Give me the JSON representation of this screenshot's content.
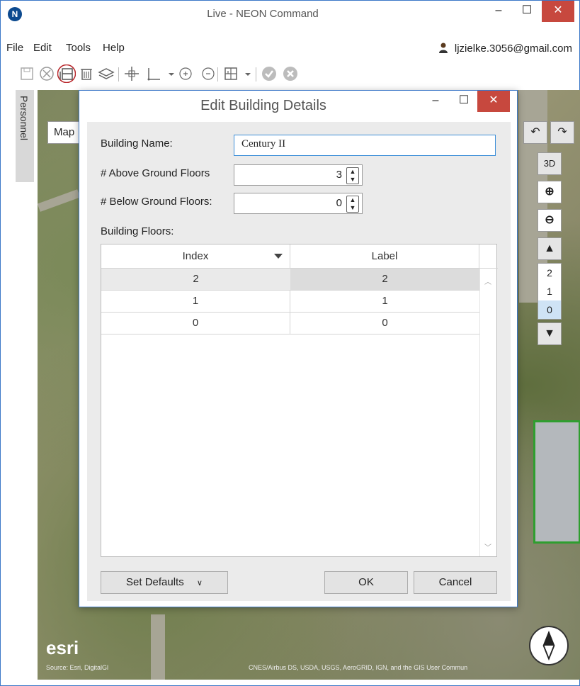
{
  "window": {
    "title": "Live - NEON Command",
    "logo_letter": "N",
    "minimize": "–",
    "maximize": "☐",
    "close": "✕"
  },
  "menu": {
    "items": [
      "File",
      "Edit",
      "Tools",
      "Help"
    ],
    "user_email": "ljzielke.3056@gmail.com"
  },
  "toolbar": {
    "icons": [
      "save-icon",
      "cancel-circle-icon",
      "edit-building-icon",
      "delete-icon",
      "layers-icon",
      "move-icon",
      "draw-line-icon",
      "zoom-in-icon",
      "zoom-out-icon",
      "floor-plan-icon",
      "check-icon",
      "close-circle-icon"
    ]
  },
  "sidetab": {
    "label": "Personnel"
  },
  "map": {
    "tab_label": "Map",
    "btn_3d": "3D",
    "floors": [
      "2",
      "1",
      "0"
    ],
    "selected_floor": "0",
    "esri": "esri",
    "attribution_left": "Source: Esri, DigitalGl",
    "attribution_right": "CNES/Airbus DS, USDA, USGS, AeroGRID, IGN, and the GIS User Commun"
  },
  "dialog": {
    "title": "Edit Building Details",
    "minimize": "–",
    "maximize": "☐",
    "close": "✕",
    "building_name_label": "Building Name:",
    "building_name_value": "Century II",
    "above_label": "# Above Ground Floors",
    "above_value": "3",
    "below_label": "# Below Ground Floors:",
    "below_value": "0",
    "floors_label": "Building Floors:",
    "grid": {
      "columns": [
        "Index",
        "Label"
      ],
      "rows": [
        {
          "index": "2",
          "label": "2"
        },
        {
          "index": "1",
          "label": "1"
        },
        {
          "index": "0",
          "label": "0"
        }
      ]
    },
    "set_defaults": "Set Defaults",
    "ok": "OK",
    "cancel": "Cancel"
  },
  "colors": {
    "accent_blue": "#3c78c8",
    "close_red": "#c7483e",
    "building_outline": "#2f9e2f"
  }
}
